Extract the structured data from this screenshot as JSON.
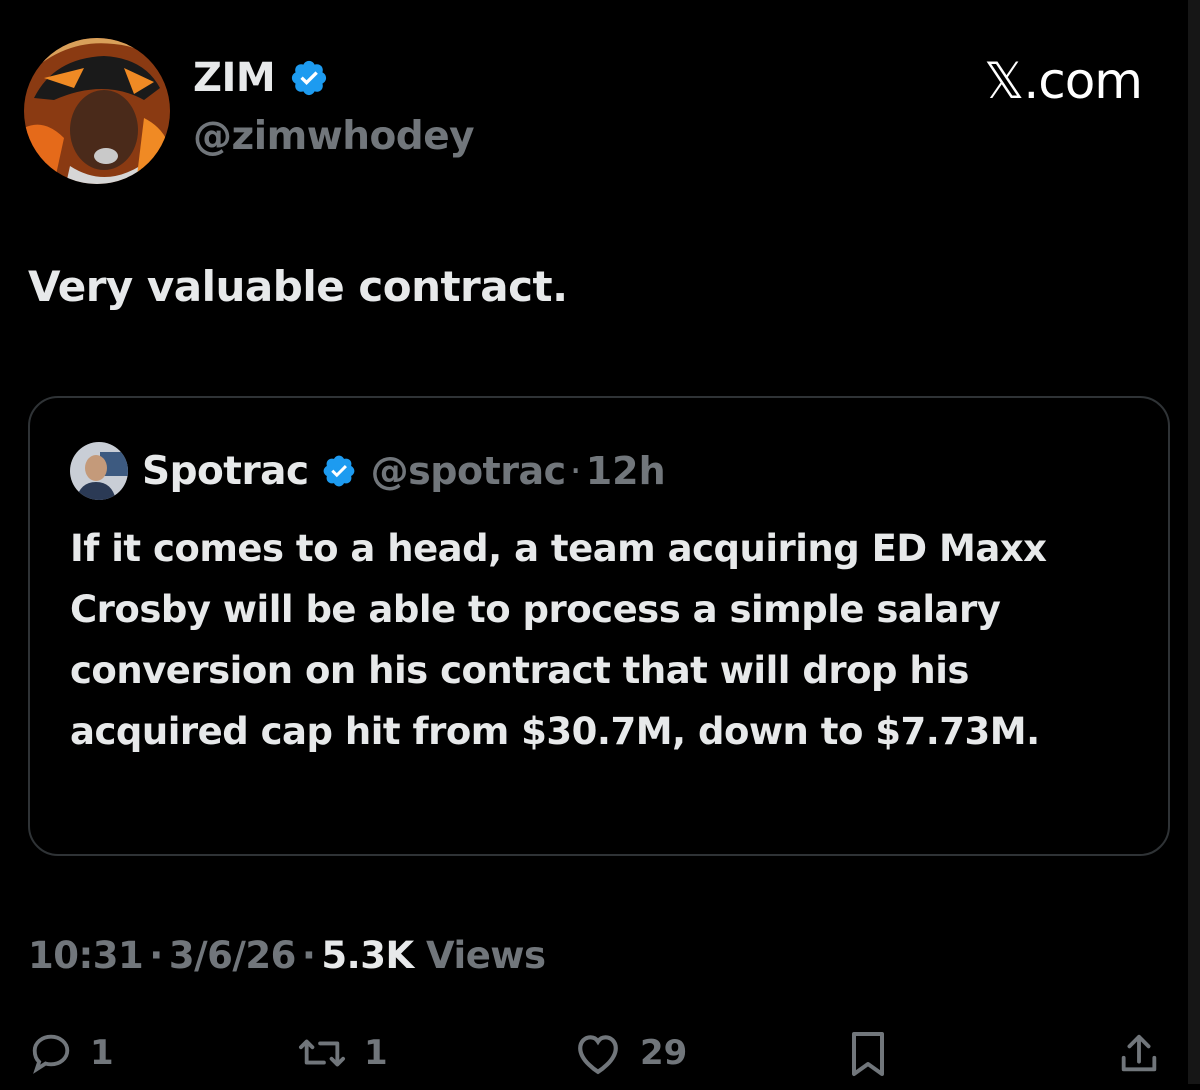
{
  "tweet": {
    "author_name": "ZIM",
    "author_handle": "@zimwhodey",
    "text": "Very valuable contract.",
    "time": "10:31",
    "date": "3/6/26",
    "views_count": "5.3K",
    "views_label": "Views"
  },
  "watermark": "𝕏.com",
  "quoted": {
    "name": "Spotrac",
    "handle": "@spotrac",
    "time": "12h",
    "text": "If it comes to a head, a team acquiring ED Maxx Crosby will be able to process a simple salary conversion on his contract that will drop his acquired cap hit from $30.7M, down to $7.73M."
  },
  "actions": {
    "replies": "1",
    "reposts": "1",
    "likes": "29"
  },
  "icons": {
    "verified": "verified-badge-icon",
    "reply": "reply-icon",
    "repost": "repost-icon",
    "like": "heart-icon",
    "bookmark": "bookmark-icon",
    "share": "share-icon"
  },
  "colors": {
    "background": "#000000",
    "text": "#e7e9ea",
    "secondary": "#71767b",
    "verified": "#1d9bf0",
    "border": "#2f3336"
  }
}
